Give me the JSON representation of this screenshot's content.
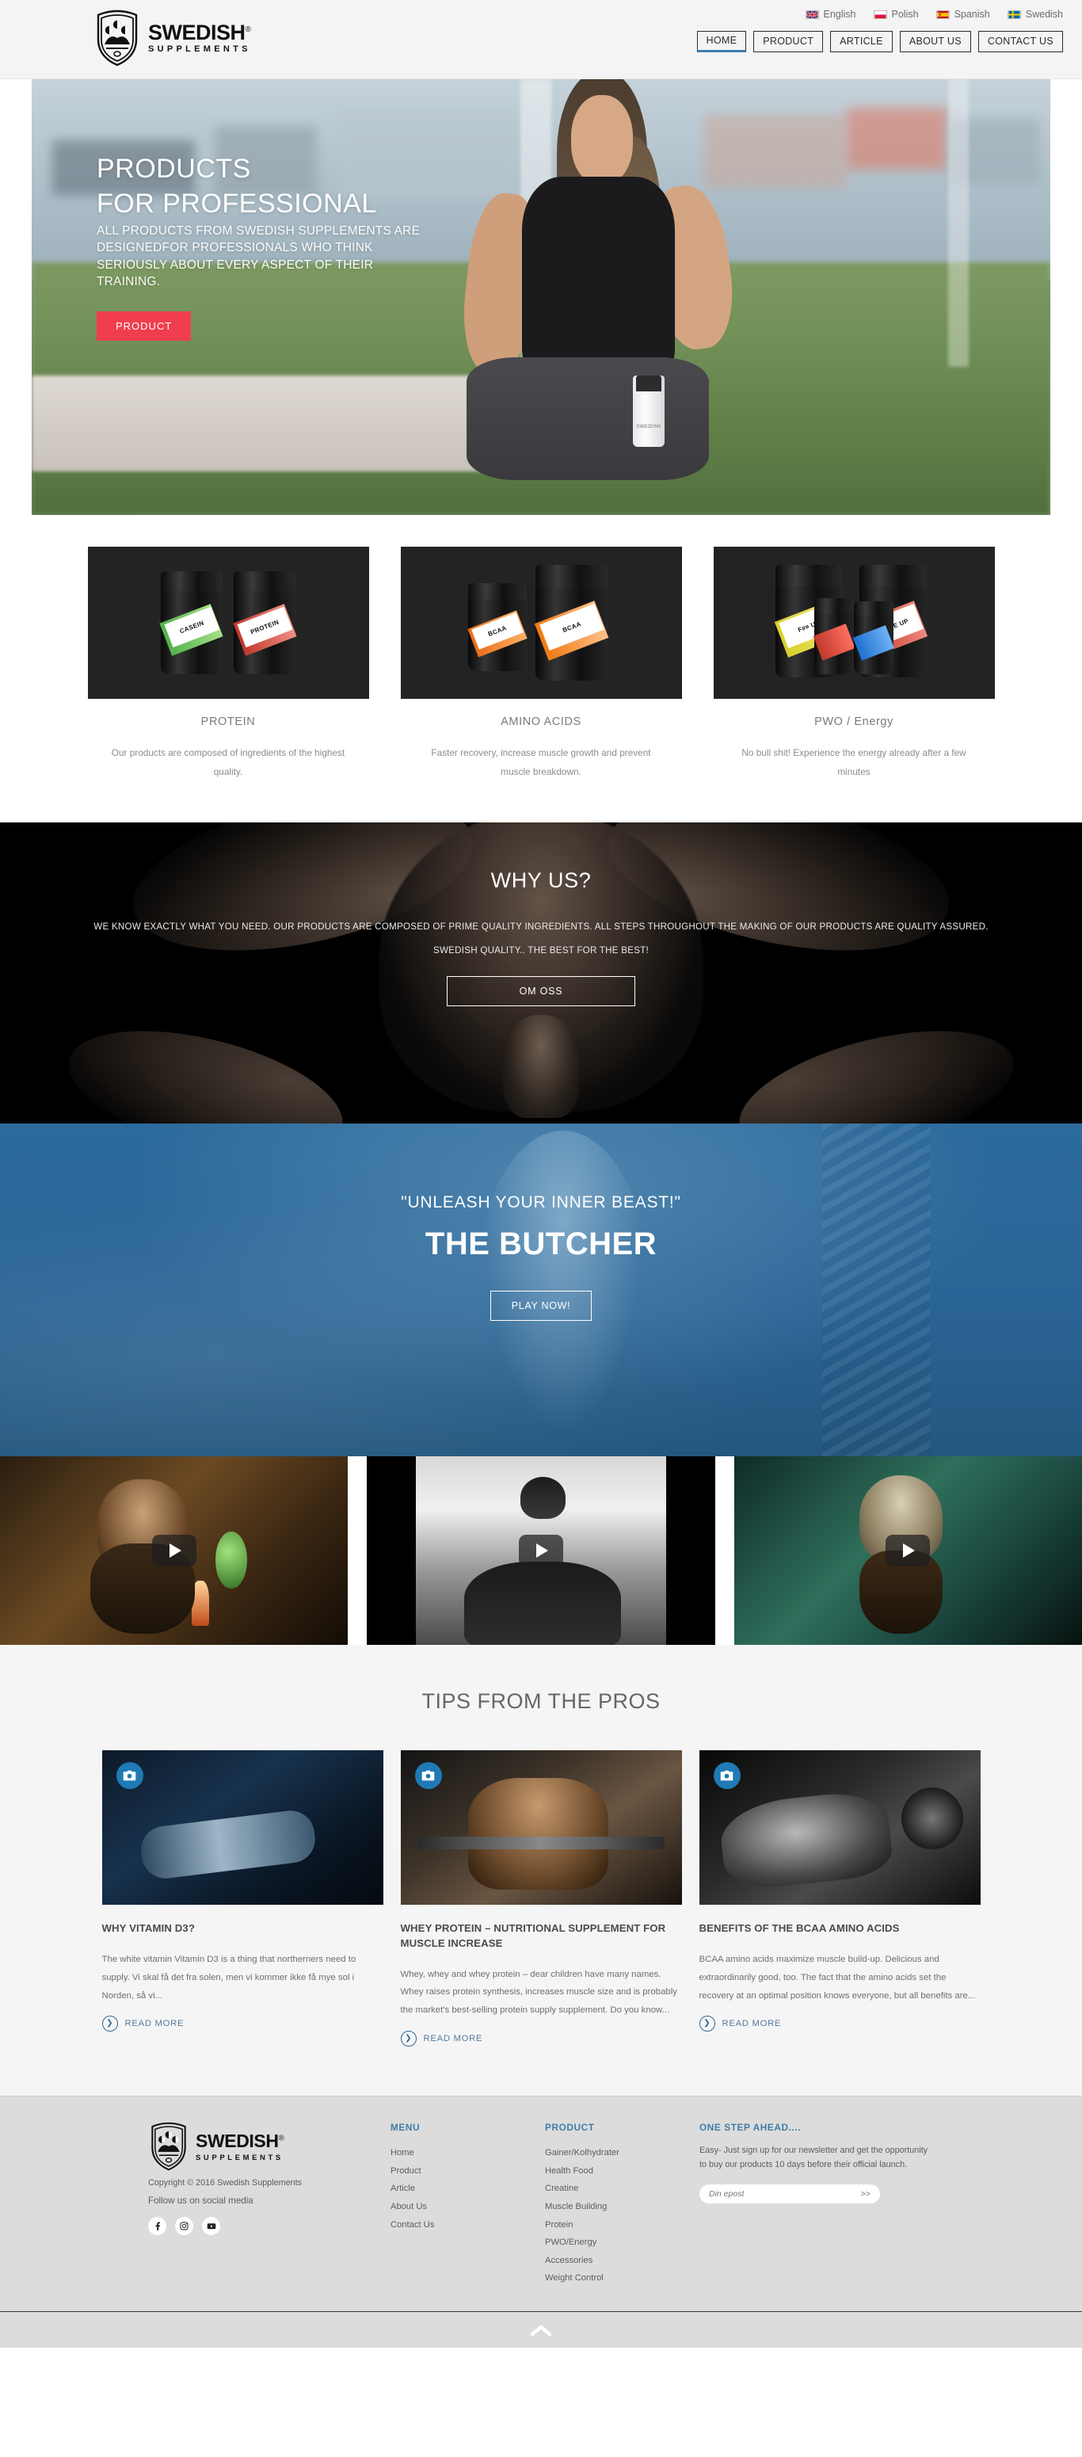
{
  "header": {
    "logo": {
      "main": "SWEDISH",
      "registered": "®",
      "sub": "SUPPLEMENTS"
    },
    "languages": [
      {
        "label": "English",
        "code": "en"
      },
      {
        "label": "Polish",
        "code": "pl"
      },
      {
        "label": "Spanish",
        "code": "es"
      },
      {
        "label": "Swedish",
        "code": "sv"
      }
    ],
    "nav": [
      {
        "label": "HOME",
        "active": true
      },
      {
        "label": "PRODUCT",
        "active": false
      },
      {
        "label": "ARTICLE",
        "active": false
      },
      {
        "label": "ABOUT US",
        "active": false
      },
      {
        "label": "CONTACT US",
        "active": false
      }
    ]
  },
  "hero": {
    "title_line1": "PRODUCTS",
    "title_line2": "FOR PROFESSIONAL",
    "subtitle": "ALL PRODUCTS FROM SWEDISH SUPPLEMENTS ARE DESIGNEDFOR PROFESSIONALS WHO THINK SERIOUSLY ABOUT EVERY ASPECT OF THEIR TRAINING.",
    "cta_label": "PRODUCT",
    "cta_color": "#f03e4e",
    "shaker_label": "SWEDISH"
  },
  "categories": [
    {
      "title": "PROTEIN",
      "desc": "Our products are composed of ingredients of the highest quality.",
      "jar_labels": [
        "CASEIN",
        "PROTEIN"
      ]
    },
    {
      "title": "AMINO ACIDS",
      "desc": "Faster recovery, increase muscle growth and prevent muscle breakdown.",
      "jar_labels": [
        "BCAA",
        "BCAA"
      ]
    },
    {
      "title": "PWO / Energy",
      "desc": "No bull shit! Experience the energy already after a few minutes",
      "jar_labels": [
        "F#¤ UP",
        "WAKE UP"
      ]
    }
  ],
  "whyus": {
    "title": "WHY US?",
    "paragraph": "WE KNOW EXACTLY WHAT YOU NEED. OUR PRODUCTS ARE COMPOSED OF PRIME QUALITY INGREDIENTS. ALL STEPS THROUGHOUT THE MAKING OF OUR PRODUCTS ARE QUALITY ASSURED.",
    "paragraph2": "SWEDISH QUALITY.. THE BEST FOR THE BEST!",
    "button_label": "OM OSS"
  },
  "butcher": {
    "tagline": "\"UNLEASH YOUR INNER BEAST!\"",
    "title": "THE BUTCHER",
    "button_label": "PLAY NOW!",
    "bg_color": "#2b6698"
  },
  "videos": [
    {
      "name": "video-thumbnail-1"
    },
    {
      "name": "video-thumbnail-2"
    },
    {
      "name": "video-thumbnail-3"
    }
  ],
  "tips": {
    "title": "TIPS FROM THE PROS",
    "read_more_label": "READ MORE",
    "articles": [
      {
        "title": "WHY VITAMIN D3?",
        "body": "The white vitamin Vitamin D3 is a thing that northerners need to supply. Vi skal få det fra solen, men vi kommer ikke få mye sol i Norden, så vi..."
      },
      {
        "title": "WHEY PROTEIN – NUTRITIONAL SUPPLEMENT FOR MUSCLE INCREASE",
        "body": "Whey, whey and whey protein – dear children have many names. Whey raises protein synthesis, increases muscle size and is probably the market's best-selling protein supply supplement. Do you know..."
      },
      {
        "title": "BENEFITS OF THE BCAA AMINO ACIDS",
        "body": "BCAA amino acids maximize muscle build-up. Delicious and extraordinarily good, too. The fact that the amino acids set the recovery at an optimal position knows everyone, but all benefits are..."
      }
    ]
  },
  "footer": {
    "logo": {
      "main": "SWEDISH",
      "registered": "®",
      "sub": "SUPPLEMENTS"
    },
    "copyright": "Copyright © 2016 Swedish Supplements",
    "follow_text": "Follow us on social media",
    "socials": [
      "facebook-icon",
      "instagram-icon",
      "youtube-icon"
    ],
    "menu": {
      "heading": "MENU",
      "items": [
        "Home",
        "Product",
        "Article",
        "About Us",
        "Contact Us"
      ]
    },
    "product": {
      "heading": "PRODUCT",
      "items": [
        "Gainer/Kolhydrater",
        "Health Food",
        "Creatine",
        "Muscle Building",
        "Protein",
        "PWO/Energy",
        "Accessories",
        "Weight Control"
      ]
    },
    "newsletter": {
      "heading": "ONE STEP AHEAD....",
      "text": "Easy- Just sign up for our newsletter and get the opportunity to buy our products 10 days before their official launch.",
      "placeholder": "Din epost",
      "submit_label": ">>"
    },
    "accent_color": "#3f7ca8"
  }
}
